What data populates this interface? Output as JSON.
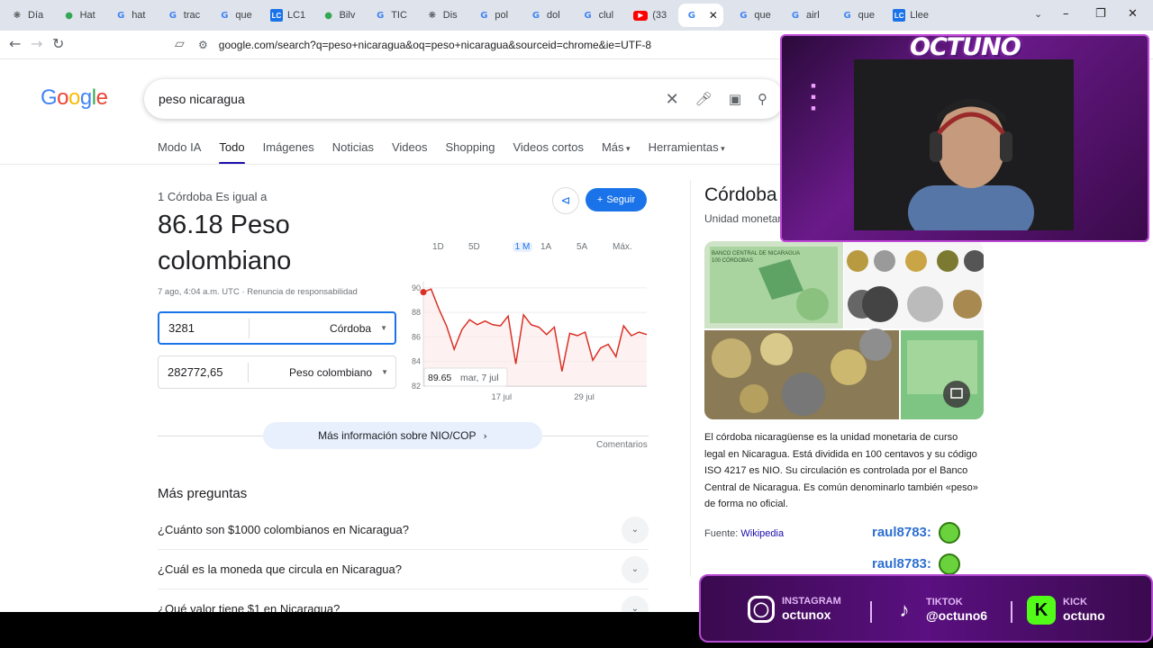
{
  "browser": {
    "tabs": [
      {
        "icon": "chatgpt-icon",
        "label": "Día"
      },
      {
        "icon": "maps-icon",
        "label": "Hat"
      },
      {
        "icon": "google-icon",
        "label": "hat"
      },
      {
        "icon": "google-icon",
        "label": "trac"
      },
      {
        "icon": "google-icon",
        "label": "que"
      },
      {
        "icon": "lc-icon",
        "label": "LC1"
      },
      {
        "icon": "maps-icon",
        "label": "Bilv"
      },
      {
        "icon": "google-icon",
        "label": "TIC"
      },
      {
        "icon": "chatgpt-icon",
        "label": "Dis"
      },
      {
        "icon": "google-icon",
        "label": "pol"
      },
      {
        "icon": "google-icon",
        "label": "dol"
      },
      {
        "icon": "google-icon",
        "label": "clul"
      },
      {
        "icon": "youtube-icon",
        "label": "(33"
      },
      {
        "icon": "google-icon",
        "label": ""
      },
      {
        "icon": "google-icon",
        "label": "que"
      },
      {
        "icon": "google-icon",
        "label": "airl"
      },
      {
        "icon": "google-icon",
        "label": "que"
      },
      {
        "icon": "lc-icon",
        "label": "Llee"
      }
    ],
    "url": "google.com/search?q=peso+nicaragua&oq=peso+nicaragua&sourceid=chrome&ie=UTF-8"
  },
  "google": {
    "logo": [
      "G",
      "o",
      "o",
      "g",
      "l",
      "e"
    ],
    "logo_colors": [
      "#4285f4",
      "#ea4335",
      "#fbbc05",
      "#4285f4",
      "#34a853",
      "#ea4335"
    ],
    "query": "peso nicaragua",
    "tabs": [
      "Modo IA",
      "Todo",
      "Imágenes",
      "Noticias",
      "Videos",
      "Shopping",
      "Videos cortos",
      "Más",
      "Herramientas"
    ]
  },
  "converter": {
    "subtitle": "1 Córdoba Es igual a",
    "result": "86.18 Peso colombiano",
    "share_label": "share-icon",
    "follow_label": "Seguir",
    "timestamp": "7 ago, 4:04 a.m. UTC · Renuncia de responsabilidad",
    "from_value": "3281",
    "from_currency": "Córdoba",
    "to_value": "282772,65",
    "to_currency": "Peso colombiano",
    "ranges": [
      "1D",
      "5D",
      "1 M",
      "1A",
      "5A",
      "Máx."
    ],
    "selected_range": "1 M",
    "more_info": "Más información sobre NIO/COP",
    "feedback": "Comentarios"
  },
  "chart_data": {
    "type": "line",
    "series": [
      {
        "values": [
          89.65,
          89.9,
          88.3,
          86.9,
          85.0,
          86.6,
          87.4,
          87.0,
          87.3,
          87.0,
          86.9,
          87.7,
          83.8,
          87.8,
          87.0,
          86.8,
          86.2,
          86.8,
          83.2,
          86.3,
          86.1,
          86.4,
          84.1,
          85.1,
          85.4,
          84.4,
          86.9,
          86.1,
          86.4,
          86.2
        ]
      }
    ],
    "x_tick_labels": [
      "17 jul",
      "29 jul"
    ],
    "y_ticks": [
      90,
      88,
      86,
      84,
      82
    ],
    "ylim": [
      82,
      90.5
    ],
    "tooltip": {
      "value": "89.65",
      "date": "mar, 7 jul"
    },
    "line_color": "#d93025"
  },
  "questions": {
    "title": "Más preguntas",
    "items": [
      "¿Cuánto son $1000 colombianos en Nicaragua?",
      "¿Cuál es la moneda que circula en Nicaragua?",
      "¿Qué valor tiene $1 en Nicaragua?"
    ]
  },
  "knowledge_panel": {
    "title": "Córdoba",
    "subtitle": "Unidad monetaria",
    "banknote_text": [
      "BANCO CENTRAL DE NICARAGUA",
      "100 CÓRDOBAS"
    ],
    "description": "El córdoba nicaragüense es la unidad monetaria de curso legal en Nicaragua. Está dividida en 100 centavos y su código ISO 4217 es NIO. Su circulación es controlada por el Banco Central de Nicaragua. Es común denominarlo también «peso» de forma no oficial.",
    "source_label": "Fuente:",
    "source_link": "Wikipedia"
  },
  "stream_overlay": {
    "brand": "OCTUNO",
    "chat": [
      {
        "user": "raul8783:"
      },
      {
        "user": "raul8783:"
      }
    ],
    "socials": [
      {
        "network": "INSTAGRAM",
        "handle": "octunox"
      },
      {
        "network": "TIKTOK",
        "handle": "@octuno6"
      },
      {
        "network": "KICK",
        "handle": "octuno"
      }
    ]
  }
}
